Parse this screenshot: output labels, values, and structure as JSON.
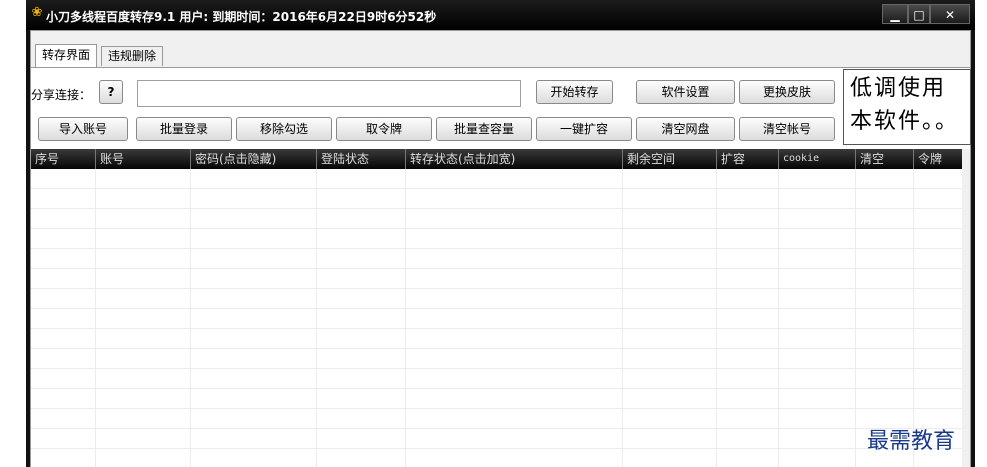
{
  "window": {
    "title": "小刀多线程百度转存9.1 用户: 到期时间：2016年6月22日9时6分52秒",
    "app_icon": "shell-logo-icon",
    "minimize_glyph": "▁",
    "maximize_glyph": "□",
    "close_glyph": "✕"
  },
  "tabs": [
    {
      "label": "转存界面",
      "active": true
    },
    {
      "label": "违规删除",
      "active": false
    }
  ],
  "share": {
    "label": "分享连接：",
    "help_label": "?",
    "value": "",
    "placeholder": ""
  },
  "toolbar": {
    "row1": [
      {
        "label": "开始转存"
      },
      {
        "label": "软件设置"
      },
      {
        "label": "更换皮肤"
      }
    ],
    "row2": [
      {
        "label": "导入账号"
      },
      {
        "label": "批量登录"
      },
      {
        "label": "移除勾选"
      },
      {
        "label": "取令牌"
      },
      {
        "label": "批量查容量"
      },
      {
        "label": "一键扩容"
      },
      {
        "label": "清空网盘"
      },
      {
        "label": "清空帐号"
      }
    ]
  },
  "notice": {
    "text": "低调使用本软件。。"
  },
  "table": {
    "columns": [
      "序号",
      "账号",
      "密码(点击隐藏)",
      "登陆状态",
      "转存状态(点击加宽)",
      "剩余空间",
      "扩容",
      "cookie",
      "清空",
      "令牌"
    ],
    "rows": []
  },
  "watermark": "最需教育"
}
